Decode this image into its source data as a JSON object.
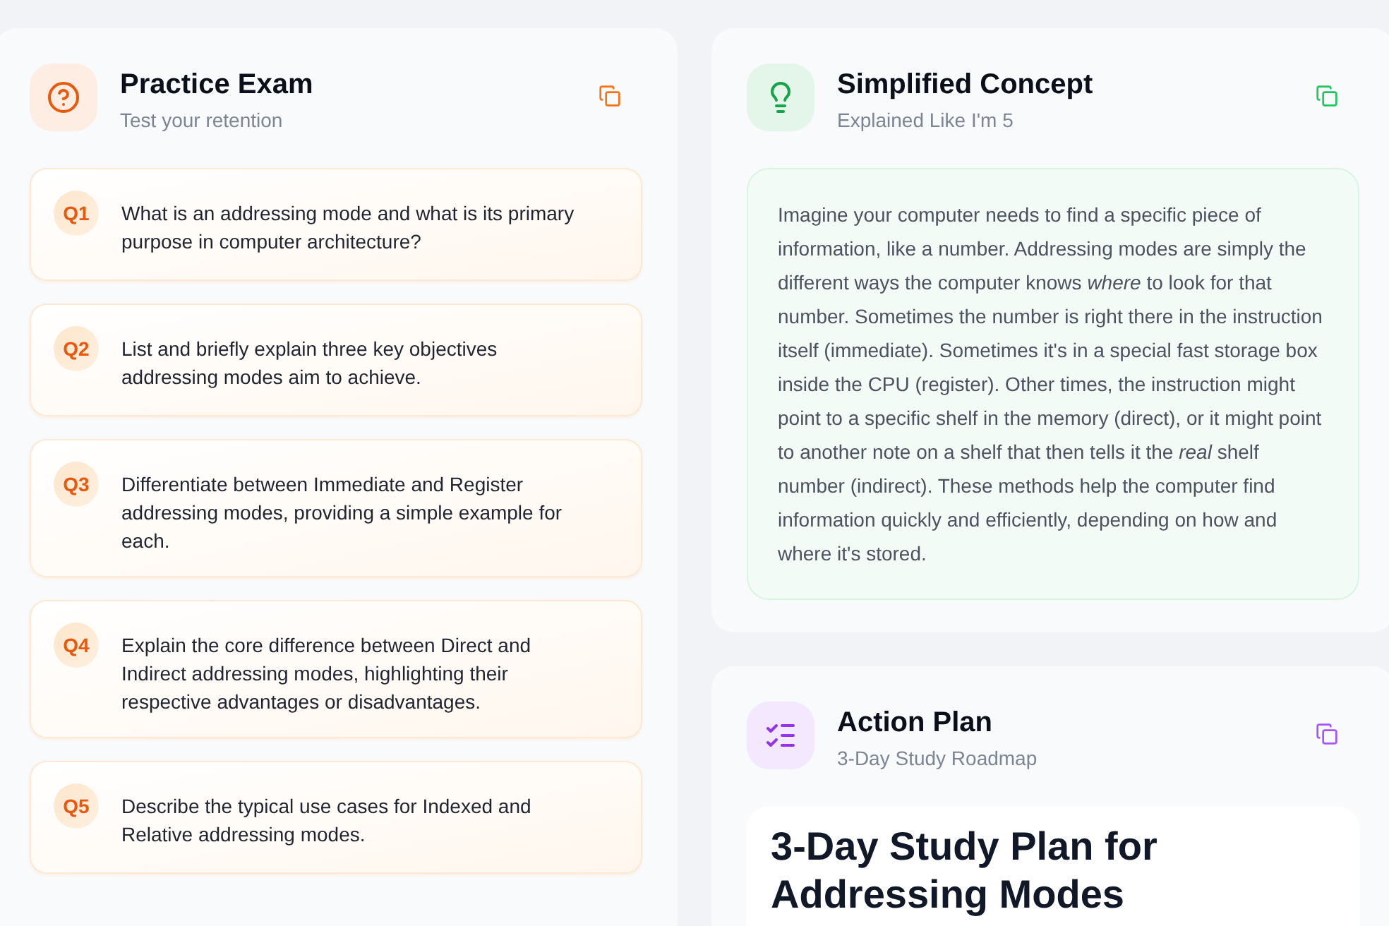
{
  "practice_exam": {
    "title": "Practice Exam",
    "subtitle": "Test your retention",
    "questions": [
      {
        "number": "Q1",
        "text": "What is an addressing mode and what is its primary purpose in computer architecture?"
      },
      {
        "number": "Q2",
        "text": "List and briefly explain three key objectives addressing modes aim to achieve."
      },
      {
        "number": "Q3",
        "text": "Differentiate between Immediate and Register addressing modes, providing a simple example for each."
      },
      {
        "number": "Q4",
        "text": "Explain the core difference between Direct and Indirect addressing modes, highlighting their respective advantages or disadvantages."
      },
      {
        "number": "Q5",
        "text": "Describe the typical use cases for Indexed and Relative addressing modes."
      }
    ]
  },
  "simplified_concept": {
    "title": "Simplified Concept",
    "subtitle": "Explained Like I'm 5",
    "body": "Imagine your computer needs to find a specific piece of information, like a number. Addressing modes are simply the different ways the computer knows *where* to look for that number. Sometimes the number is right there in the instruction itself (immediate). Sometimes it's in a special fast storage box inside the CPU (register). Other times, the instruction might point to a specific shelf in the memory (direct), or it might point to another note on a shelf that then tells it the *real* shelf number (indirect). These methods help the computer find information quickly and efficiently, depending on how and where it's stored."
  },
  "action_plan": {
    "title": "Action Plan",
    "subtitle": "3-Day Study Roadmap",
    "heading": "3-Day Study Plan for Addressing Modes"
  }
}
